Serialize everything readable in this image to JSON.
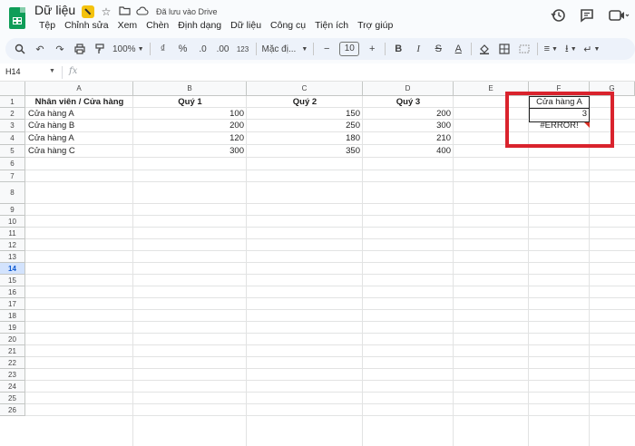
{
  "titlebar": {
    "doc_title": "Dữ liệu",
    "save_status": "Đã lưu vào Drive",
    "menu": [
      "Tệp",
      "Chỉnh sửa",
      "Xem",
      "Chèn",
      "Định dạng",
      "Dữ liệu",
      "Công cụ",
      "Tiện ích",
      "Trợ giúp"
    ]
  },
  "toolbar": {
    "zoom": "100%",
    "currency": "₫",
    "percent": "%",
    "dec_decrease": ".0",
    "dec_increase": ".00",
    "number_format": "123",
    "font": "Mặc đị...",
    "font_size": "10",
    "bold": "B",
    "italic": "I",
    "strike": "S",
    "text_color": "A"
  },
  "formula_bar": {
    "cell_ref": "H14",
    "fx": "fx",
    "content": ""
  },
  "grid": {
    "columns": [
      "A",
      "B",
      "C",
      "D",
      "E",
      "F",
      "G"
    ],
    "rows": [
      "1",
      "2",
      "3",
      "4",
      "5",
      "6",
      "7",
      "8",
      "9",
      "10",
      "11",
      "12",
      "13",
      "14",
      "15",
      "16",
      "17",
      "18",
      "19",
      "20",
      "21",
      "22",
      "23",
      "24",
      "25",
      "26"
    ],
    "active_row": "14",
    "headers": [
      "Nhân viên / Cửa hàng",
      "Quý 1",
      "Quý 2",
      "Quý 3"
    ],
    "data": [
      [
        "Cửa hàng A",
        "100",
        "150",
        "200"
      ],
      [
        "Cửa hàng B",
        "200",
        "250",
        "300"
      ],
      [
        "Cửa hàng A",
        "120",
        "180",
        "210"
      ],
      [
        "Cửa hàng C",
        "300",
        "350",
        "400"
      ]
    ],
    "f1": "Cửa hàng A",
    "f2": "3",
    "f3": "#ERROR!"
  },
  "colors": {
    "highlight": "#d9232d",
    "sheets_green": "#0f9d58",
    "error_marker": "#d93025"
  }
}
